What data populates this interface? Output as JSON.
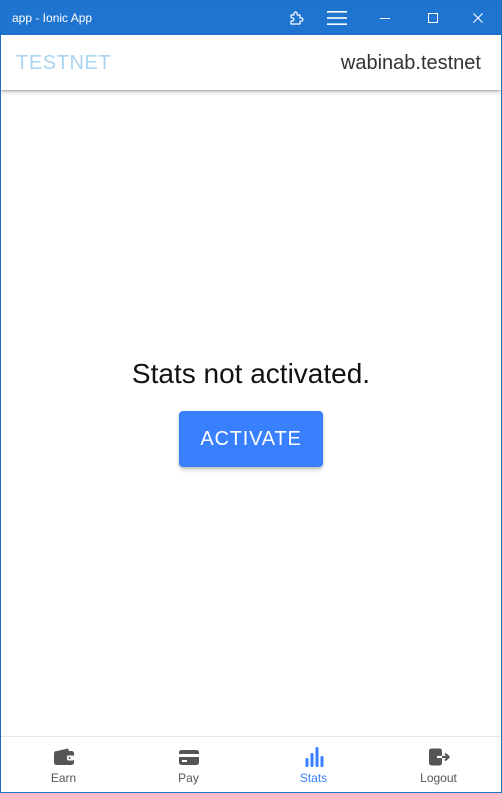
{
  "window": {
    "title": "app - Ionic App",
    "accent_color": "#1f74d0",
    "buttons": [
      "extensions-icon",
      "menu-icon",
      "minimize-icon",
      "maximize-icon",
      "close-icon"
    ]
  },
  "header": {
    "network_label": "TESTNET",
    "network_color": "#a9d4f2",
    "account_name": "wabinab.testnet"
  },
  "main": {
    "message": "Stats not activated.",
    "activate_label": "ACTIVATE",
    "button_color": "#3880ff"
  },
  "tabs": [
    {
      "label": "Earn",
      "icon": "wallet-icon",
      "selected": false
    },
    {
      "label": "Pay",
      "icon": "card-icon",
      "selected": false
    },
    {
      "label": "Stats",
      "icon": "stats-chart-icon",
      "selected": true
    },
    {
      "label": "Logout",
      "icon": "logout-icon",
      "selected": false
    }
  ],
  "selected_tab_color": "#3880ff"
}
